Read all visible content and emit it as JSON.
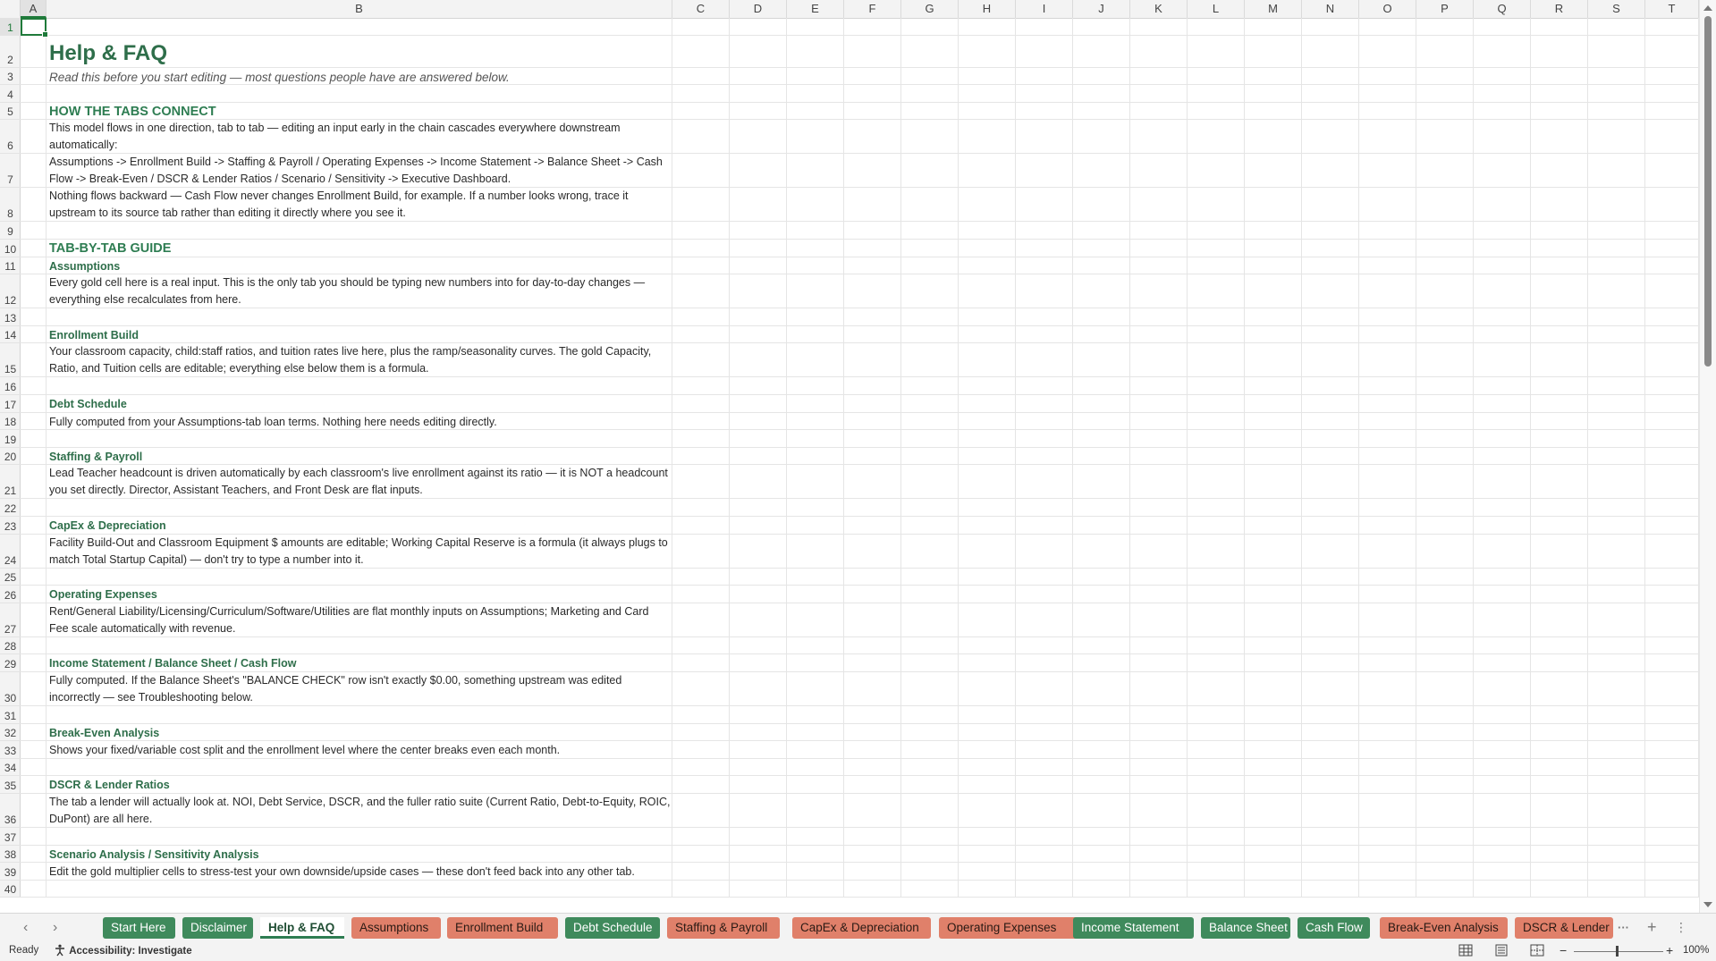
{
  "columns": [
    "A",
    "B",
    "C",
    "D",
    "E",
    "F",
    "G",
    "H",
    "I",
    "J",
    "K",
    "L",
    "M",
    "N",
    "O",
    "P",
    "Q",
    "R",
    "S",
    "T"
  ],
  "selected_cell": {
    "column": "A",
    "row": 1
  },
  "rows": [
    {
      "r": "1",
      "text": "",
      "style": ""
    },
    {
      "r": "2",
      "text": "Help & FAQ",
      "style": "title"
    },
    {
      "r": "3",
      "text": "Read this before you start editing — most questions people have are answered below.",
      "style": "subtitle"
    },
    {
      "r": "4",
      "text": "",
      "style": ""
    },
    {
      "r": "5",
      "text": "HOW THE TABS CONNECT",
      "style": "section"
    },
    {
      "r": "6",
      "text": "This model flows in one direction, tab to tab — editing an input early in the chain cascades everywhere downstream automatically:",
      "style": ""
    },
    {
      "r": "7",
      "text": "Assumptions -> Enrollment Build -> Staffing & Payroll / Operating Expenses -> Income Statement -> Balance Sheet -> Cash Flow -> Break-Even / DSCR & Lender Ratios / Scenario / Sensitivity -> Executive Dashboard.",
      "style": ""
    },
    {
      "r": "8",
      "text": "Nothing flows backward — Cash Flow never changes Enrollment Build, for example. If a number looks wrong, trace it upstream to its source tab rather than editing it directly where you see it.",
      "style": ""
    },
    {
      "r": "9",
      "text": "",
      "style": ""
    },
    {
      "r": "10",
      "text": "TAB-BY-TAB GUIDE",
      "style": "section"
    },
    {
      "r": "11",
      "text": "Assumptions",
      "style": "tab"
    },
    {
      "r": "12",
      "text": "Every gold cell here is a real input. This is the only tab you should be typing new numbers into for day-to-day changes — everything else recalculates from here.",
      "style": ""
    },
    {
      "r": "13",
      "text": "",
      "style": ""
    },
    {
      "r": "14",
      "text": "Enrollment Build",
      "style": "tab"
    },
    {
      "r": "15",
      "text": "Your classroom capacity, child:staff ratios, and tuition rates live here, plus the ramp/seasonality curves. The gold Capacity, Ratio, and Tuition cells are editable; everything else below them is a formula.",
      "style": ""
    },
    {
      "r": "16",
      "text": "",
      "style": ""
    },
    {
      "r": "17",
      "text": "Debt Schedule",
      "style": "tab"
    },
    {
      "r": "18",
      "text": "Fully computed from your Assumptions-tab loan terms. Nothing here needs editing directly.",
      "style": ""
    },
    {
      "r": "19",
      "text": "",
      "style": ""
    },
    {
      "r": "20",
      "text": "Staffing & Payroll",
      "style": "tab"
    },
    {
      "r": "21",
      "text": "Lead Teacher headcount is driven automatically by each classroom's live enrollment against its ratio — it is NOT a headcount you set directly. Director, Assistant Teachers, and Front Desk are flat inputs.",
      "style": ""
    },
    {
      "r": "22",
      "text": "",
      "style": ""
    },
    {
      "r": "23",
      "text": "CapEx & Depreciation",
      "style": "tab"
    },
    {
      "r": "24",
      "text": "Facility Build-Out and Classroom Equipment $ amounts are editable; Working Capital Reserve is a formula (it always plugs to match Total Startup Capital) — don't try to type a number into it.",
      "style": ""
    },
    {
      "r": "25",
      "text": "",
      "style": ""
    },
    {
      "r": "26",
      "text": "Operating Expenses",
      "style": "tab"
    },
    {
      "r": "27",
      "text": "Rent/General Liability/Licensing/Curriculum/Software/Utilities are flat monthly inputs on Assumptions; Marketing and Card Fee scale automatically with revenue.",
      "style": ""
    },
    {
      "r": "28",
      "text": "",
      "style": ""
    },
    {
      "r": "29",
      "text": "Income Statement / Balance Sheet / Cash Flow",
      "style": "tab"
    },
    {
      "r": "30",
      "text": "Fully computed. If the Balance Sheet's \"BALANCE CHECK\" row isn't exactly $0.00, something upstream was edited incorrectly — see Troubleshooting below.",
      "style": ""
    },
    {
      "r": "31",
      "text": "",
      "style": ""
    },
    {
      "r": "32",
      "text": "Break-Even Analysis",
      "style": "tab"
    },
    {
      "r": "33",
      "text": "Shows your fixed/variable cost split and the enrollment level where the center breaks even each month.",
      "style": ""
    },
    {
      "r": "34",
      "text": "",
      "style": ""
    },
    {
      "r": "35",
      "text": "DSCR & Lender Ratios",
      "style": "tab"
    },
    {
      "r": "36",
      "text": "The tab a lender will actually look at. NOI, Debt Service, DSCR, and the fuller ratio suite (Current Ratio, Debt-to-Equity, ROIC, DuPont) are all here.",
      "style": ""
    },
    {
      "r": "37",
      "text": "",
      "style": ""
    },
    {
      "r": "38",
      "text": "Scenario Analysis / Sensitivity Analysis",
      "style": "tab"
    },
    {
      "r": "39",
      "text": "Edit the gold multiplier cells to stress-test your own downside/upside cases — these don't feed back into any other tab.",
      "style": ""
    },
    {
      "r": "40",
      "text": "",
      "style": ""
    }
  ],
  "tabs": [
    {
      "label": "Start Here",
      "color": "green"
    },
    {
      "label": "Disclaimer",
      "color": "green"
    },
    {
      "label": "Help & FAQ",
      "color": "active"
    },
    {
      "label": "Assumptions",
      "color": "salmon"
    },
    {
      "label": "Enrollment Build",
      "color": "salmon"
    },
    {
      "label": "Debt Schedule",
      "color": "green"
    },
    {
      "label": "Staffing & Payroll",
      "color": "salmon"
    },
    {
      "label": "CapEx & Depreciation",
      "color": "salmon"
    },
    {
      "label": "Operating Expenses",
      "color": "salmon"
    },
    {
      "label": "Income Statement",
      "color": "green"
    },
    {
      "label": "Balance Sheet",
      "color": "green"
    },
    {
      "label": "Cash Flow",
      "color": "green"
    },
    {
      "label": "Break-Even Analysis",
      "color": "salmon"
    },
    {
      "label": "DSCR & Lender",
      "color": "salmon"
    }
  ],
  "tab_colors": {
    "green": "#3f8a5c",
    "salmon": "#e0806a",
    "accent": "#1f7a3a"
  },
  "tabbar": {
    "prev_icon": "‹",
    "next_icon": "›",
    "more_icon": "···",
    "add_icon": "+",
    "options_icon": "⋮"
  },
  "status": {
    "ready": "Ready",
    "accessibility": "Accessibility: Investigate",
    "zoom_out": "−",
    "zoom_in": "+",
    "zoom": "100%"
  }
}
